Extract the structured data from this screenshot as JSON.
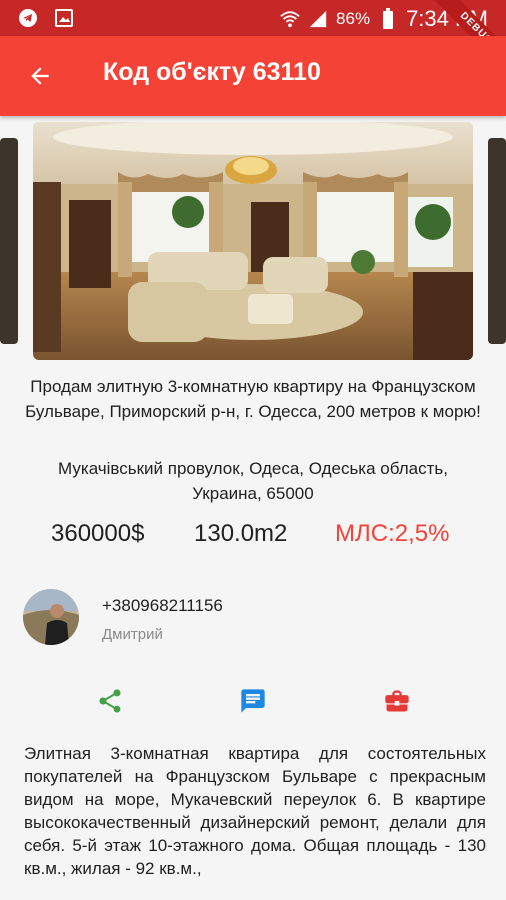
{
  "status_bar": {
    "battery": "86%",
    "time": "7:34 PM",
    "debug_label": "DEBUG",
    "icons": [
      "telegram-icon",
      "gallery-icon",
      "wifi-icon",
      "signal-icon",
      "battery-icon"
    ]
  },
  "app_bar": {
    "title": "Код об'єкту 63110",
    "back_icon": "arrow-back-icon"
  },
  "listing": {
    "title": "Продам элитную 3-комнатную квартиру на Французском Бульваре, Приморский р-н,  г. Одесса, 200 метров к морю!",
    "address": "Мукачівський провулок, Одеса, Одеська область, Украина, 65000",
    "price": "360000$",
    "area": "130.0m2",
    "commission": "МЛС:2,5%",
    "description": "Элитная 3-комнатная квартира для состоятельных покупателей на Французском Бульваре с прекрасным видом на море, Мукачевский переулок 6. В квартире высококачественный дизайнерский ремонт, делали для себя. 5-й этаж 10-этажного дома. Общая площадь - 130 кв.м., жилая - 92 кв.м.,"
  },
  "agent": {
    "phone": "+380968211156",
    "name": "Дмитрий"
  },
  "actions": {
    "share_icon": "share-icon",
    "message_icon": "message-icon",
    "briefcase_icon": "briefcase-icon"
  },
  "colors": {
    "status_bar": "#c62828",
    "app_bar": "#f44336",
    "accent_red": "#f44336",
    "share_green": "#43a047",
    "message_blue": "#1e88e5",
    "briefcase_red": "#e53935"
  }
}
